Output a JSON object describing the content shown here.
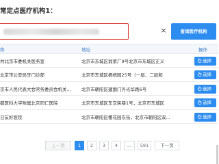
{
  "dialog": {
    "title": "常定点医疗机构1："
  },
  "search": {
    "value": "",
    "clear_label": "×",
    "button_label": "查询医疗机构"
  },
  "table": {
    "headers": {
      "name": "称",
      "address": "地址",
      "operation": "操作"
    },
    "select_label": "选择",
    "rows": [
      {
        "name": "共北京市委机关医务室",
        "address": "北京市东城区翁菜厂9号北京市东城区正义"
      },
      {
        "name": "北京市公安局牙门诊部",
        "address": "北京市东城区栖梧园25号（一层、二层和"
      },
      {
        "name": "京市人民代表大会常务委员会机关...",
        "address": "北京市朝阳区建国门外光华路6号"
      },
      {
        "name": "都医科大学附属北京同仁医院",
        "address": "北京市东城区东交民巷1号，北京市东城区"
      },
      {
        "name": "日友好医院",
        "address": "北京市朝阳区樱花园东街，北京市朝阳区双..."
      }
    ]
  },
  "pagination": {
    "prev": "上一页",
    "pages": [
      "1",
      "2",
      "3",
      "4",
      "...",
      "591"
    ],
    "active_page": "1",
    "next": "下一页"
  },
  "colors": {
    "accent": "#2d8cf0",
    "input_border": "#d9362f",
    "header_text": "#3d7cc9"
  }
}
